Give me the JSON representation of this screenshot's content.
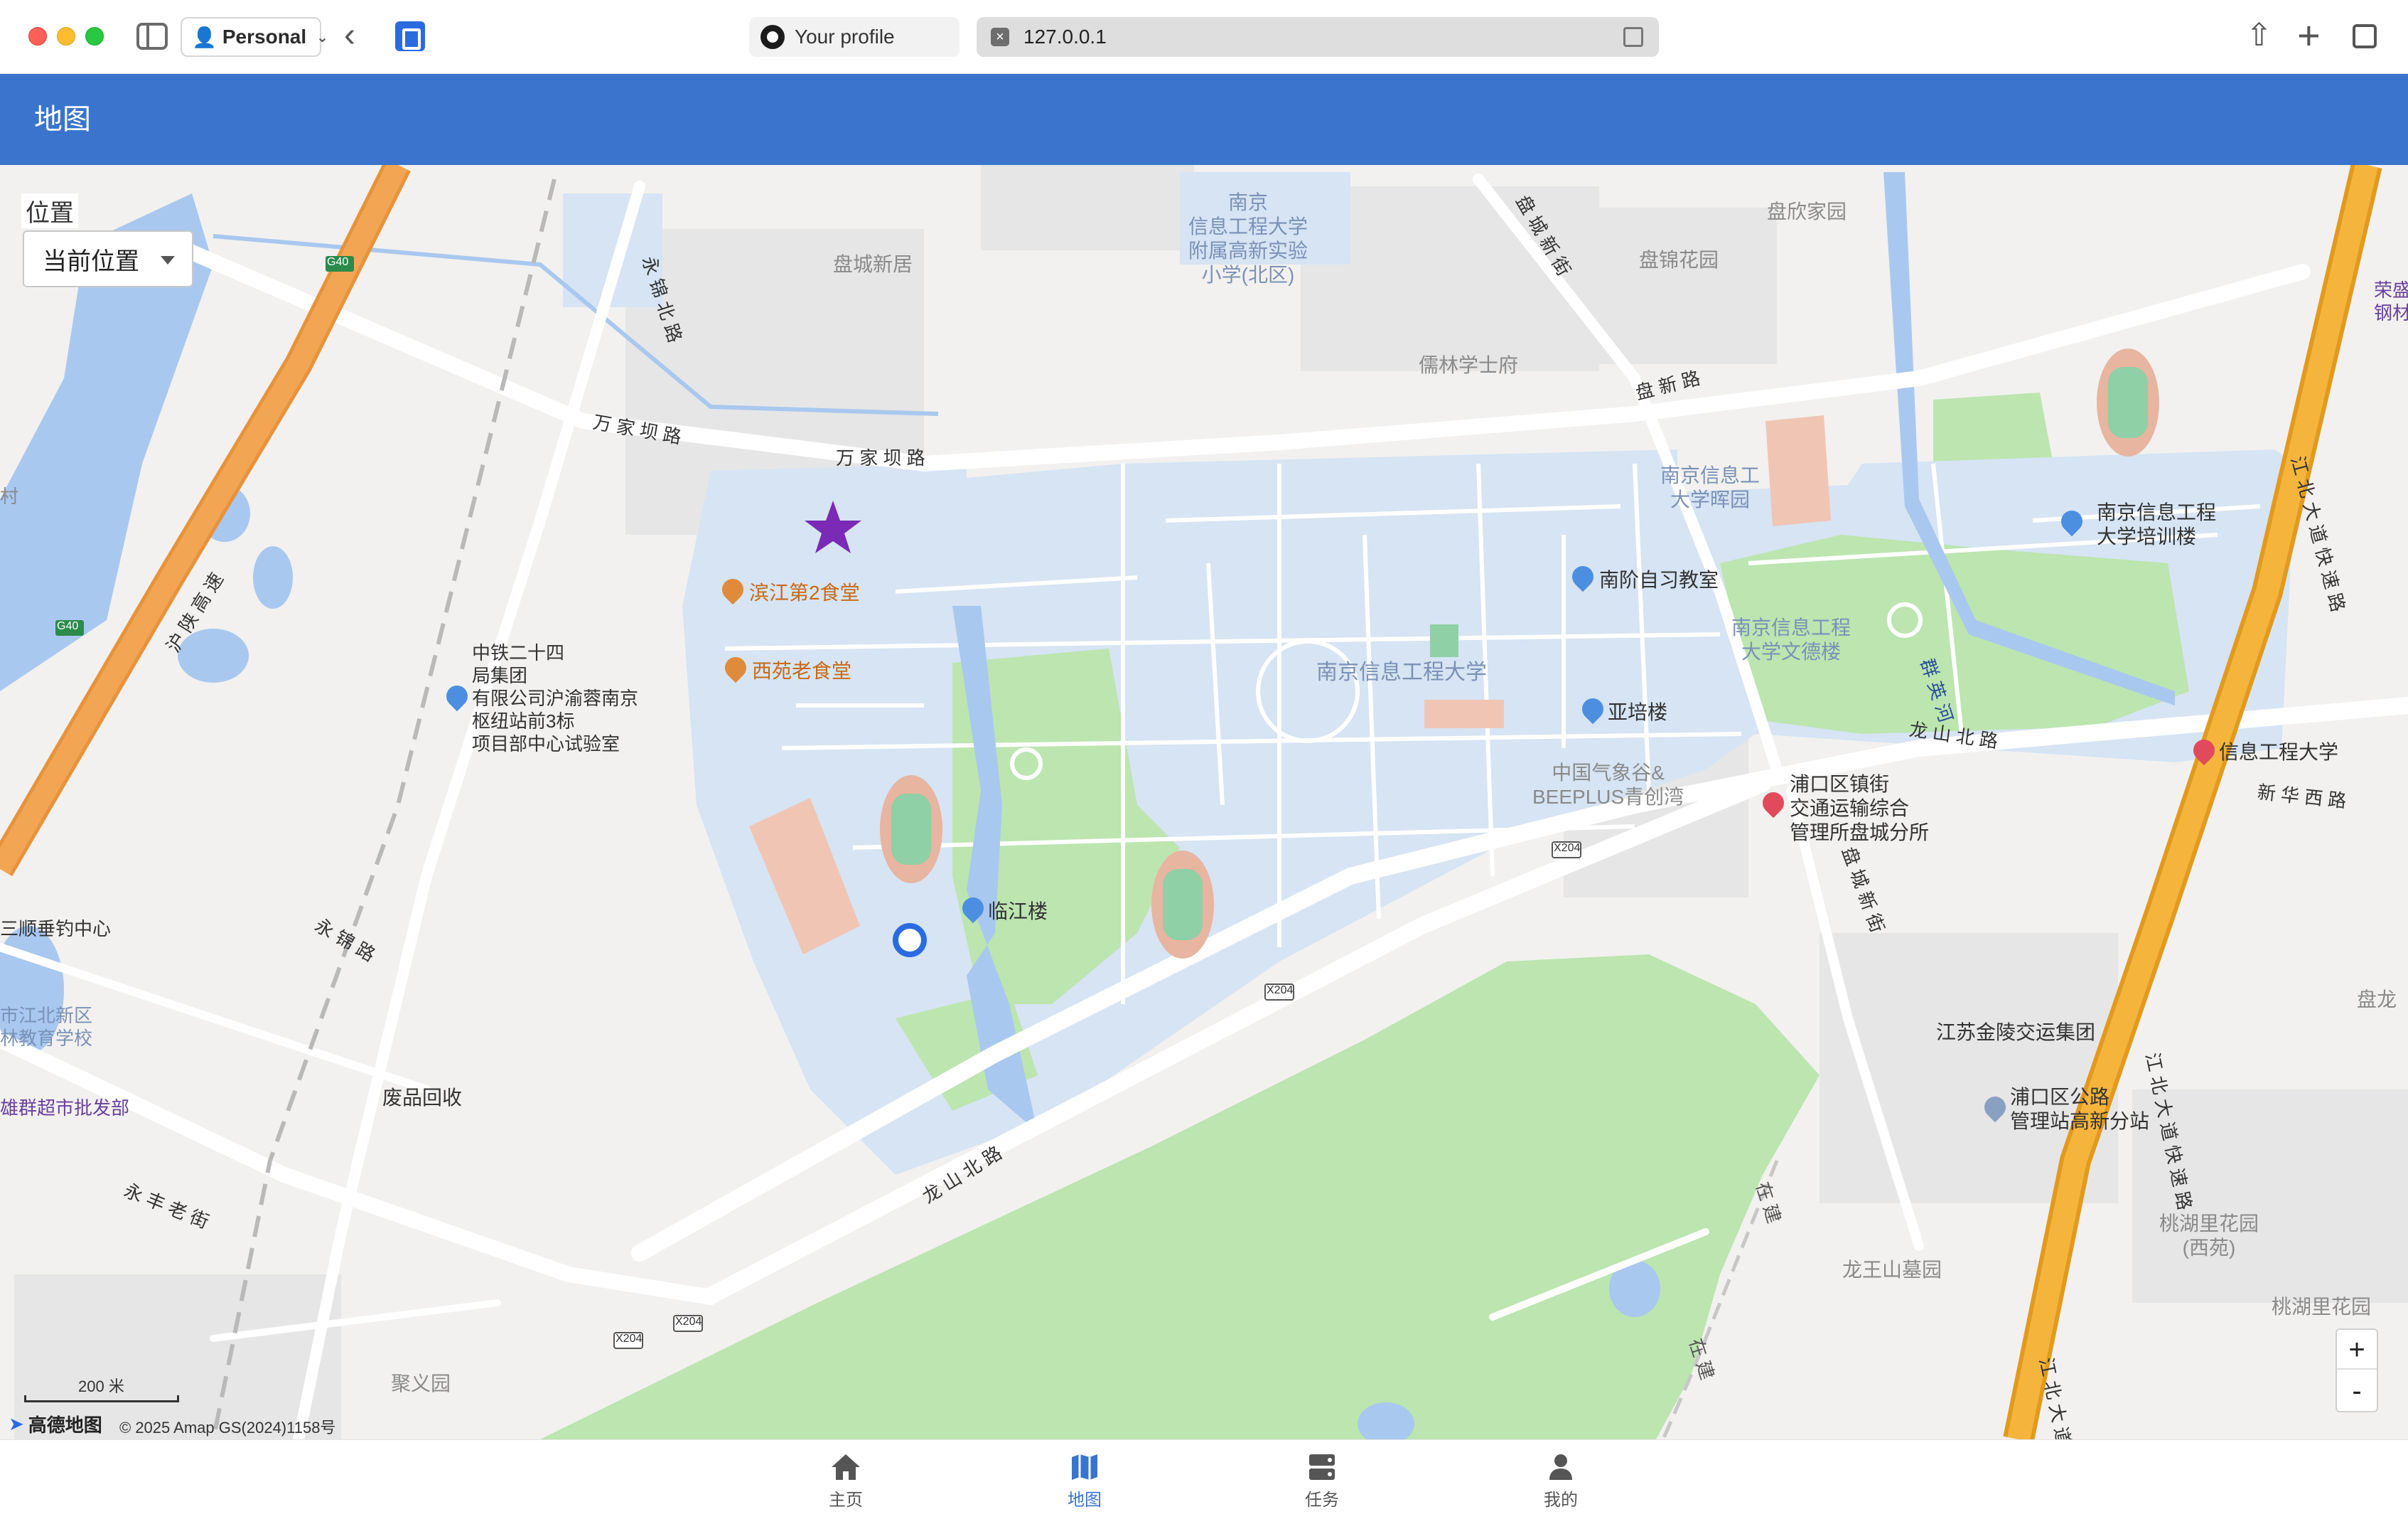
{
  "browser": {
    "profile_name": "Personal",
    "tab_title": "Your profile",
    "url": "127.0.0.1"
  },
  "app": {
    "title": "地图",
    "location_label": "位置",
    "location_value": "当前位置",
    "zoom_in_label": "+",
    "zoom_out_label": "-"
  },
  "map": {
    "scale_label": "200 米",
    "logo_text": "高德地图",
    "attribution": "© 2025 Amap GS(2024)1158号",
    "roads": {
      "wanjiaba_1": "万 家 坝 路",
      "wanjiaba_2": "万 家 坝 路",
      "panxin": "盘 新 路",
      "longshanbei_1": "龙 山 北 路",
      "longshanbei_2": "龙 山 北 路",
      "yongjin_1": "永 锦 路",
      "yongjinbei": "永 锦 北 路",
      "yongfenglao": "永 丰 老 街",
      "panchengxin_1": "盘 城 新 街",
      "panchengxin_2": "盘 城 新 街",
      "jiangbei_1": "江 北 大 道 快 速 路",
      "jiangbei_2": "江 北 大 道 快 速 路",
      "jiangbei_3": "江 北 大 道",
      "xinhuaxi": "新 华 西 路",
      "huning": "沪 陕 高 速",
      "qunying": "群 英 河",
      "zaijian_1": "在 建",
      "zaijian_2": "在 建",
      "g40_1": "G40",
      "g40_2": "G40",
      "x204_1": "X204",
      "x204_2": "X204",
      "x204_3": "X204",
      "x204_4": "X204"
    },
    "places": {
      "school_north": "南京\n信息工程大学\n附属高新实验\n小学(北区)",
      "pancheng_xinju": "盘城新居",
      "panxin_jiayuan": "盘欣家园",
      "panjin_huayuan": "盘锦花园",
      "rulin_xueshifu": "儒林学士府",
      "huiyuan": "南京信息工\n大学晖园",
      "peixunlou": "南京信息工程\n大学培训楼",
      "nanjie_zixi": "南阶自习教室",
      "nuist": "南京信息工程大学",
      "wendelou": "南京信息工程\n大学文德楼",
      "yapeilou": "亚培楼",
      "weather_valley": "中国气象谷&\nBEEPLUS青创湾",
      "transport": "浦口区镇街\n交通运输综合\n管理所盘城分所",
      "xinxi_daxue": "信息工程大学",
      "binjiang_canteen": "滨江第2食堂",
      "xiyuan_canteen": "西苑老食堂",
      "crcc": "中铁二十四\n局集团\n有限公司沪渝蓉南京\n枢纽站前3标\n项目部中心试验室",
      "linjianglou": "临江楼",
      "jinling_transport": "江苏金陵交运集团",
      "highway_station": "浦口区公路\n管理站高新分站",
      "taohu_xi": "桃湖里花园\n(西苑)",
      "taohu": "桃湖里花园",
      "longwang": "龙王山墓园",
      "recycle": "废品回收",
      "sanshun": "三顺垂钓中心",
      "jiangbei_school": "市江北新区\n林教育学校",
      "supermarket": "雄群超市批发部",
      "juyiyuan": "聚义园",
      "panlong": "盘龙",
      "rongsheng": "荣盛\n钢材",
      "cun": "村"
    }
  },
  "nav": {
    "home": "主页",
    "map": "地图",
    "tasks": "任务",
    "mine": "我的"
  },
  "colors": {
    "header": "#3a74cc",
    "campus": "#d6e4f3",
    "park": "#bce5b0",
    "water": "#a9c8ef",
    "expressway": "#f5b53d",
    "expressway_outline": "#e29a1e",
    "highway_g40": "#f2a653",
    "star_marker": "#7b2ab5"
  }
}
